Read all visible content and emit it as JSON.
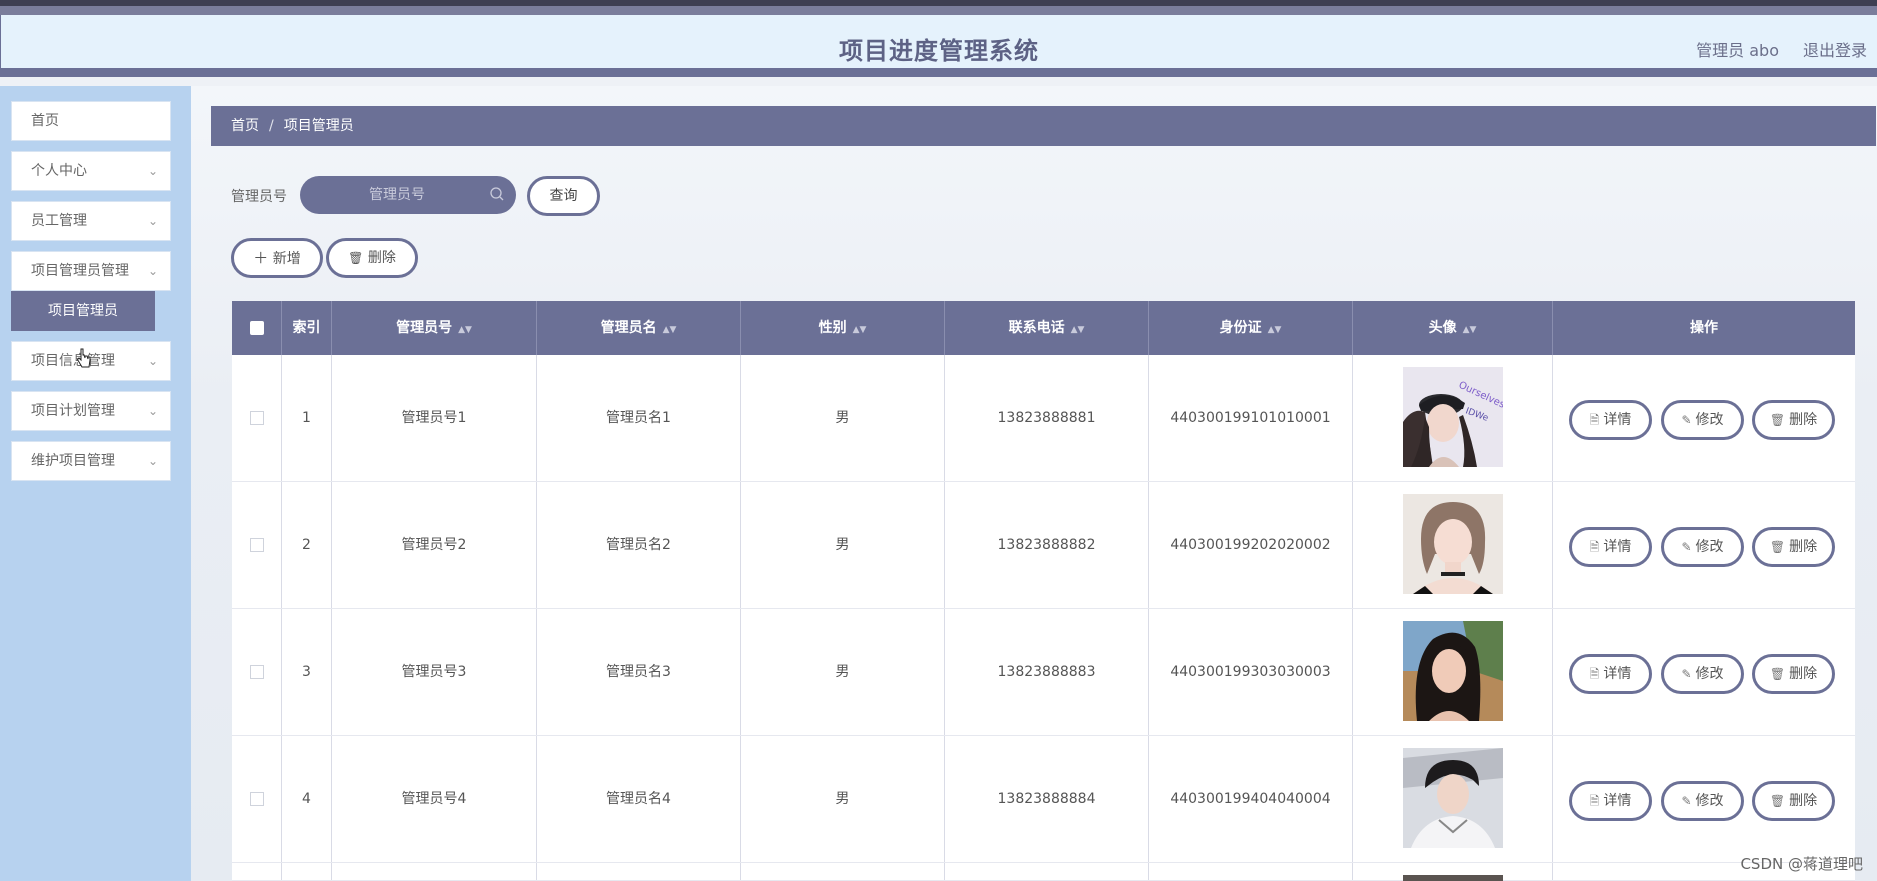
{
  "header": {
    "title": "项目进度管理系统",
    "user": "管理员 abo",
    "logout": "退出登录"
  },
  "sidebar": {
    "items": [
      {
        "label": "首页",
        "has_chevron": false
      },
      {
        "label": "个人中心",
        "has_chevron": true
      },
      {
        "label": "员工管理",
        "has_chevron": true
      },
      {
        "label": "项目管理员管理",
        "has_chevron": true
      },
      {
        "label": "项目信息管理",
        "has_chevron": true
      },
      {
        "label": "项目计划管理",
        "has_chevron": true
      },
      {
        "label": "维护项目管理",
        "has_chevron": true
      }
    ],
    "sub_item": "项目管理员"
  },
  "breadcrumb": {
    "home": "首页",
    "separator": "/",
    "current": "项目管理员"
  },
  "search": {
    "label": "管理员号",
    "placeholder": "管理员号",
    "query_button": "查询"
  },
  "actions": {
    "add": "新增",
    "delete": "删除"
  },
  "table": {
    "headers": [
      "索引",
      "管理员号",
      "管理员名",
      "性别",
      "联系电话",
      "身份证",
      "头像",
      "操作"
    ],
    "rows": [
      {
        "index": "1",
        "admin_no": "管理员号1",
        "admin_name": "管理员名1",
        "gender": "男",
        "phone": "13823888881",
        "id_card": "440300199101010001"
      },
      {
        "index": "2",
        "admin_no": "管理员号2",
        "admin_name": "管理员名2",
        "gender": "男",
        "phone": "13823888882",
        "id_card": "440300199202020002"
      },
      {
        "index": "3",
        "admin_no": "管理员号3",
        "admin_name": "管理员名3",
        "gender": "男",
        "phone": "13823888883",
        "id_card": "440300199303030003"
      },
      {
        "index": "4",
        "admin_no": "管理员号4",
        "admin_name": "管理员名4",
        "gender": "男",
        "phone": "13823888884",
        "id_card": "440300199404040004"
      }
    ],
    "row_actions": {
      "detail": "详情",
      "edit": "修改",
      "delete": "删除"
    }
  },
  "watermark": "CSDN @蒋道理吧",
  "colors": {
    "primary": "#6b7096",
    "sidebar_bg": "#b7d2ef",
    "header_bg": "#e5f2fc"
  }
}
